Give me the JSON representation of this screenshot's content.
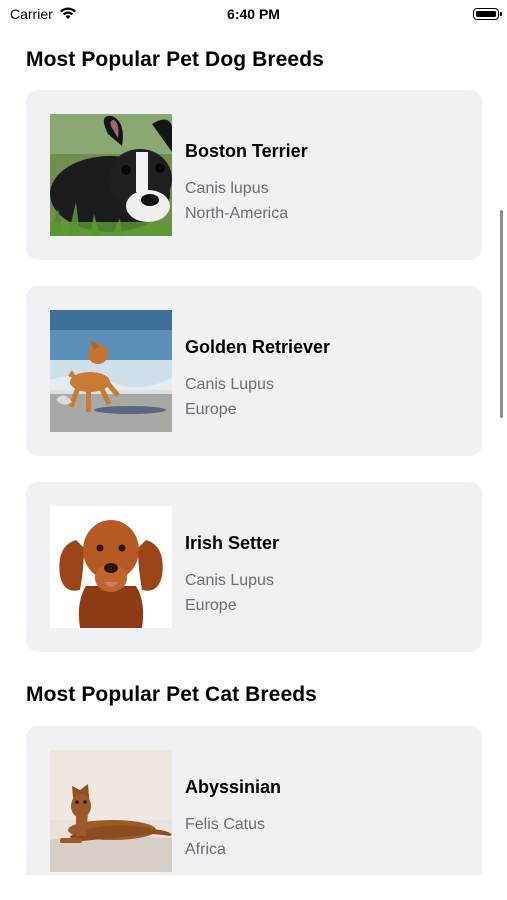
{
  "status_bar": {
    "carrier": "Carrier",
    "time": "6:40 PM",
    "icons": [
      "wifi-icon",
      "battery-icon"
    ]
  },
  "sections": [
    {
      "title": "Most Popular Pet Dog Breeds",
      "items": [
        {
          "name": "Boston Terrier",
          "species": "Canis lupus",
          "region": "North-America",
          "photo": "boston-terrier-photo"
        },
        {
          "name": "Golden Retriever",
          "species": "Canis Lupus",
          "region": "Europe",
          "photo": "golden-retriever-photo"
        },
        {
          "name": "Irish Setter",
          "species": "Canis Lupus",
          "region": "Europe",
          "photo": "irish-setter-photo"
        }
      ]
    },
    {
      "title": "Most Popular Pet Cat Breeds",
      "items": [
        {
          "name": "Abyssinian",
          "species": "Felis Catus",
          "region": "Africa",
          "photo": "abyssinian-photo"
        }
      ]
    }
  ],
  "colors": {
    "card_background": "#f0f0f5",
    "secondary_text": "#6d6d72",
    "primary_text": "#000000"
  }
}
